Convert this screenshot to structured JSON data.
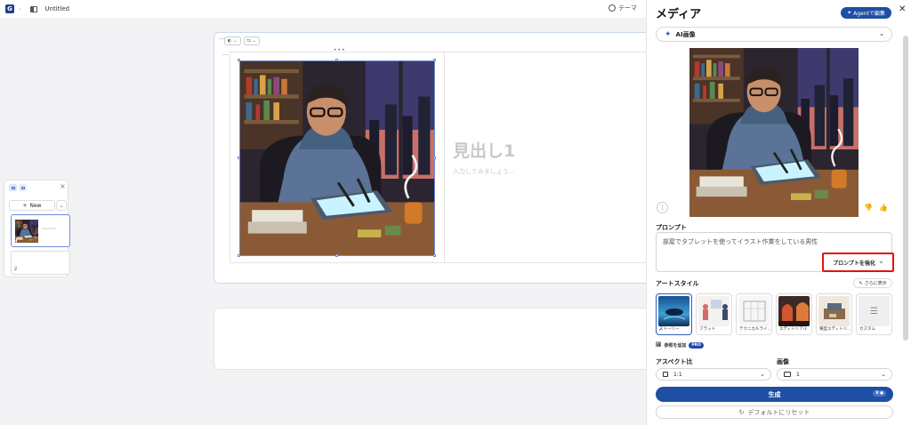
{
  "app": {
    "doc_title": "Untitled",
    "theme_label": "テーマ"
  },
  "slide_panel": {
    "new_label": "New",
    "thumbnails": [
      {
        "number": "1"
      },
      {
        "number": "2"
      }
    ]
  },
  "canvas": {
    "heading": "見出し1",
    "placeholder": "入力してみましょう..."
  },
  "media_panel": {
    "title": "メディア",
    "agent_button": "Agentで編集",
    "source_select": "AI画像",
    "prompt_label": "プロンプト",
    "prompt_text": "部屋でタブレットを使ってイラスト作業をしている男性",
    "enhance_button": "プロンプトを強化",
    "art_style_label": "アートスタイル",
    "show_more": "さらに表示",
    "styles": [
      {
        "name": "ストーリー",
        "selected": true
      },
      {
        "name": "フラット",
        "selected": false
      },
      {
        "name": "テクニカルライ...",
        "selected": false
      },
      {
        "name": "エディトリアル",
        "selected": false
      },
      {
        "name": "横型エディトリ...",
        "selected": false
      },
      {
        "name": "カスタム",
        "selected": false
      }
    ],
    "add_reference": "参照を追加",
    "pro_badge": "PRO",
    "aspect_label": "アスペクト比",
    "aspect_value": "1:1",
    "image_count_label": "画像",
    "image_count_value": "1",
    "generate_button": "生成",
    "generate_cost": "8 ●",
    "reset_button": "デフォルトにリセット"
  },
  "colors": {
    "accent": "#1d4fa5",
    "highlight": "#e31111",
    "canvas_bg": "#f3f3f5"
  }
}
